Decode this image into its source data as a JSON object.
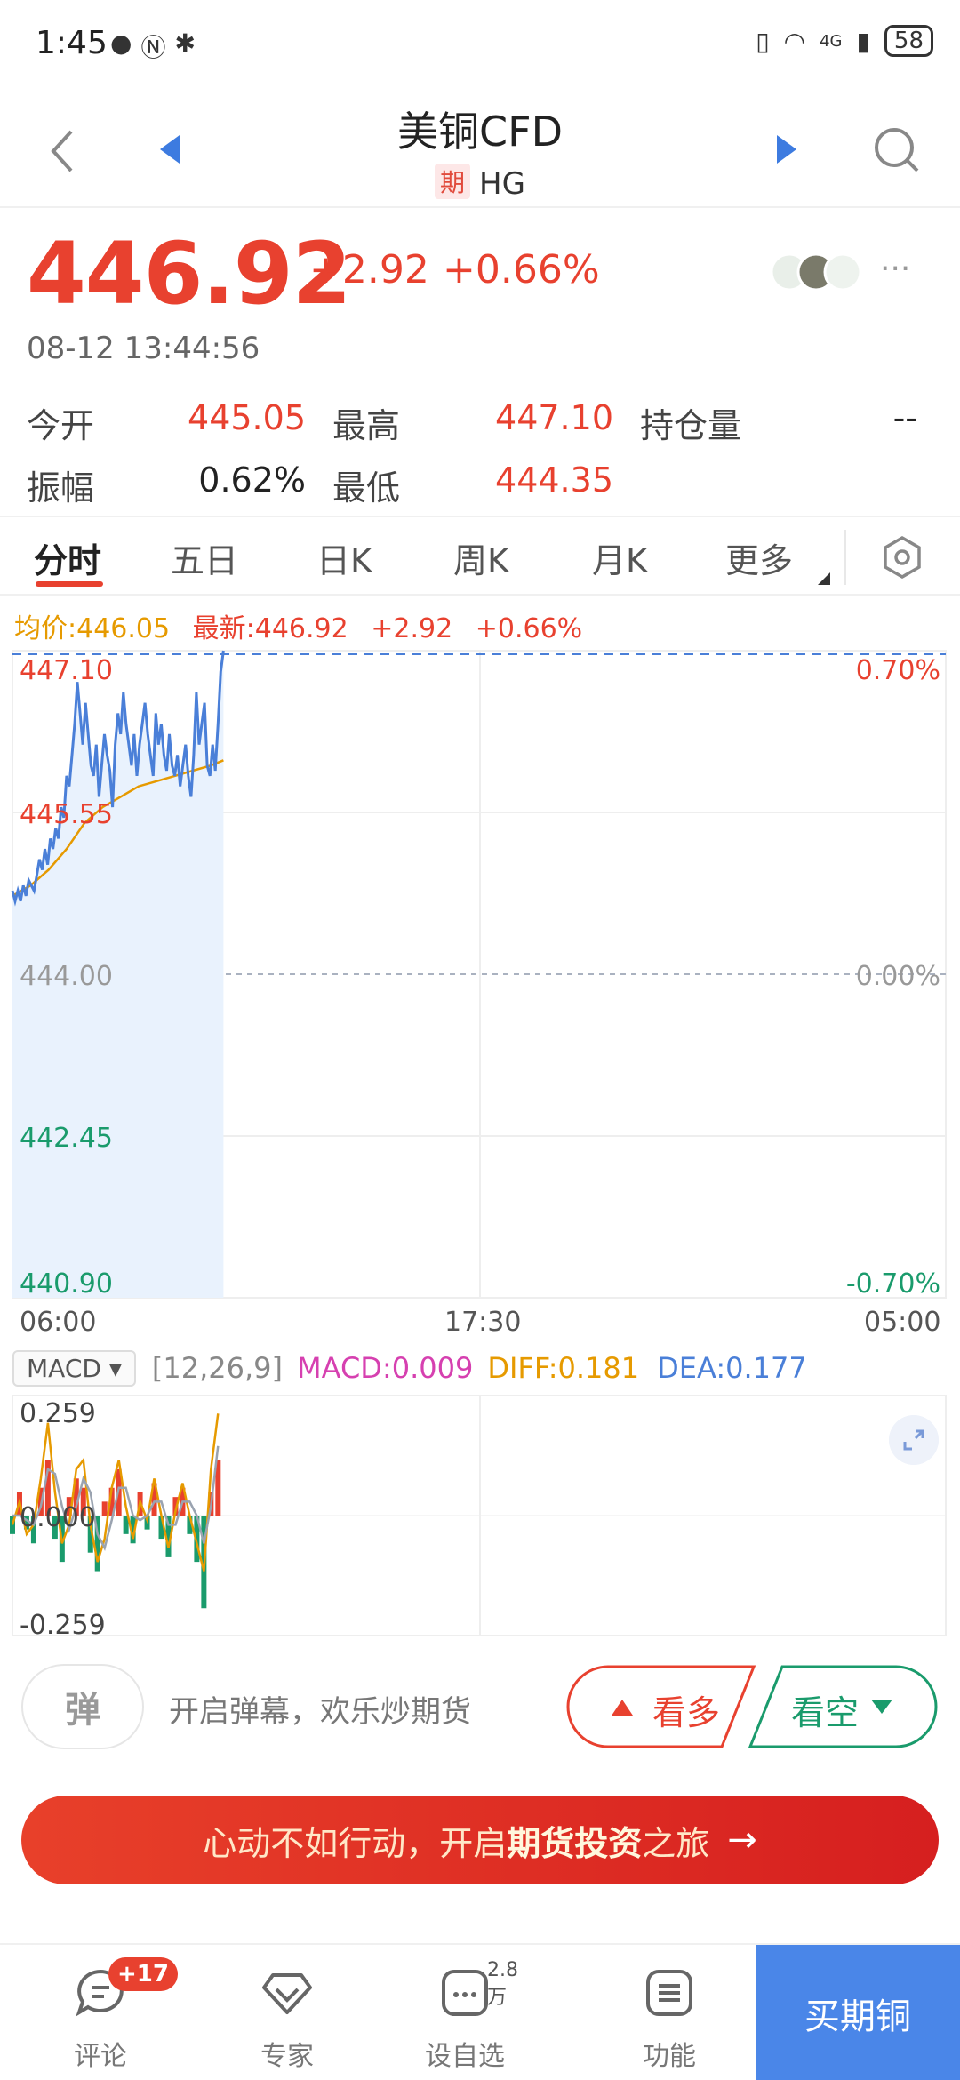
{
  "status_bar": {
    "time": "1:45",
    "battery": "58",
    "network": "4G"
  },
  "header": {
    "title": "美铜CFD",
    "badge": "期",
    "code": "HG"
  },
  "quote": {
    "price": "446.92",
    "change": "+2.92",
    "change_pct": "+0.66%",
    "timestamp": "08-12 13:44:56",
    "more": "···"
  },
  "stats": {
    "open_label": "今开",
    "open": "445.05",
    "high_label": "最高",
    "high": "447.10",
    "oi_label": "持仓量",
    "oi": "--",
    "amp_label": "振幅",
    "amp": "0.62%",
    "low_label": "最低",
    "low": "444.35"
  },
  "tabs": [
    "分时",
    "五日",
    "日K",
    "周K",
    "月K",
    "更多"
  ],
  "chart_info": {
    "avg": "均价:446.05",
    "latest": "最新:446.92",
    "change": "+2.92",
    "pct": "+0.66%"
  },
  "time_axis": [
    "06:00",
    "17:30",
    "05:00"
  ],
  "macd": {
    "selector": "MACD",
    "params": "[12,26,9]",
    "macd": "MACD:0.009",
    "diff": "DIFF:0.181",
    "dea": "DEA:0.177"
  },
  "danmu": {
    "button": "弹",
    "prompt": "开启弹幕，欢乐炒期货"
  },
  "sentiment": {
    "bull": "看多",
    "bear": "看空"
  },
  "banner": {
    "pre": "心动不如行动，开启",
    "bold": "期货投资",
    "post": "之旅",
    "arrow": "→"
  },
  "nav": {
    "comments": "评论",
    "comments_badge": "+17",
    "experts": "专家",
    "watch": "设自选",
    "watch_count": "2.8万",
    "functions": "功能",
    "buy": "买期铜"
  },
  "colors": {
    "up": "#e8412f",
    "down": "#1a9b6c",
    "price_line": "#4a7fd8",
    "avg_line": "#e69a00",
    "accent": "#4a86e8"
  },
  "chart_data": [
    {
      "type": "line",
      "y_ticks_left": [
        "447.10",
        "445.55",
        "444.00",
        "442.45",
        "440.90"
      ],
      "y_ticks_right": [
        "0.70%",
        "0.00%",
        "-0.70%"
      ],
      "ylim": [
        440.9,
        447.1
      ],
      "x_ticks": [
        "06:00",
        "17:30",
        "05:00"
      ],
      "x_index_range": [
        0,
        230
      ],
      "reference": 444.0,
      "latest": 446.92,
      "series": [
        {
          "name": "价格",
          "x": [
            0,
            3,
            6,
            9,
            12,
            15,
            18,
            21,
            24,
            27,
            30,
            33,
            36,
            39,
            42,
            45,
            48,
            51,
            54,
            57,
            60,
            63,
            66,
            69,
            72,
            75,
            78,
            81,
            84,
            87,
            90,
            93,
            96,
            99,
            102,
            105,
            108,
            111,
            114,
            117,
            120,
            123,
            126,
            129,
            132,
            135,
            138,
            141,
            144,
            147,
            150,
            153,
            156,
            159,
            162,
            165,
            168,
            171,
            174,
            177,
            180,
            183,
            186,
            189,
            192,
            195,
            198,
            201,
            204,
            207,
            210,
            213,
            216,
            219,
            222,
            225,
            228,
            231,
            234
          ],
          "values": [
            444.8,
            444.7,
            444.8,
            444.7,
            444.85,
            444.75,
            444.9,
            444.85,
            444.8,
            444.95,
            445.1,
            445.0,
            445.2,
            445.05,
            445.3,
            445.2,
            445.4,
            445.3,
            445.6,
            445.5,
            445.9,
            445.8,
            446.1,
            446.4,
            446.8,
            446.5,
            446.2,
            446.6,
            446.3,
            446.0,
            445.9,
            446.2,
            445.7,
            446.0,
            446.3,
            446.1,
            445.95,
            445.6,
            446.2,
            446.5,
            446.3,
            446.7,
            446.4,
            446.2,
            446.0,
            446.3,
            445.9,
            446.2,
            446.4,
            446.6,
            446.3,
            446.1,
            445.9,
            446.5,
            446.2,
            446.4,
            446.1,
            445.95,
            446.3,
            446.0,
            445.9,
            446.1,
            445.8,
            446.0,
            446.2,
            445.9,
            445.7,
            446.1,
            446.7,
            446.2,
            446.4,
            446.6,
            446.0,
            445.9,
            446.2,
            445.95,
            446.4,
            446.9,
            447.1
          ]
        },
        {
          "name": "均价",
          "x": [
            0,
            20,
            40,
            60,
            80,
            100,
            120,
            140,
            160,
            180,
            200,
            220,
            234
          ],
          "values": [
            444.75,
            444.85,
            445.0,
            445.2,
            445.45,
            445.6,
            445.7,
            445.8,
            445.85,
            445.9,
            445.95,
            446.0,
            446.05
          ]
        }
      ]
    },
    {
      "type": "bar",
      "title": "MACD",
      "params": "[12,26,9]",
      "y_ticks": [
        "0.259",
        "0.000",
        "-0.259"
      ],
      "ylim": [
        -0.259,
        0.259
      ],
      "latest": {
        "macd": 0.009,
        "diff": 0.181,
        "dea": 0.177
      },
      "x": [
        0,
        8,
        16,
        24,
        32,
        40,
        48,
        56,
        64,
        72,
        80,
        88,
        96,
        104,
        112,
        120,
        128,
        136,
        144,
        152,
        160,
        168,
        176,
        184,
        192,
        200,
        208,
        216,
        224,
        232
      ],
      "series": [
        {
          "name": "MACD",
          "values": [
            -0.04,
            0.05,
            -0.03,
            -0.06,
            0.06,
            0.12,
            -0.05,
            -0.1,
            0.04,
            0.08,
            0.06,
            -0.08,
            -0.12,
            0.03,
            0.06,
            0.1,
            -0.04,
            -0.06,
            0.05,
            -0.03,
            0.07,
            -0.05,
            -0.09,
            0.04,
            0.06,
            -0.04,
            -0.1,
            -0.2,
            0.05,
            0.12
          ]
        },
        {
          "name": "DIFF",
          "values": [
            -0.02,
            0.03,
            -0.04,
            -0.02,
            0.08,
            0.2,
            0.05,
            -0.06,
            -0.02,
            0.1,
            0.12,
            -0.02,
            -0.1,
            -0.05,
            0.06,
            0.12,
            0.02,
            -0.05,
            0.03,
            -0.01,
            0.08,
            0.0,
            -0.07,
            0.01,
            0.07,
            0.0,
            -0.06,
            -0.12,
            0.1,
            0.22
          ]
        },
        {
          "name": "DEA",
          "values": [
            0.0,
            0.0,
            -0.01,
            -0.02,
            0.02,
            0.1,
            0.09,
            0.02,
            -0.03,
            0.02,
            0.08,
            0.05,
            -0.04,
            -0.07,
            -0.01,
            0.06,
            0.06,
            0.0,
            -0.01,
            0.0,
            0.03,
            0.03,
            -0.02,
            -0.02,
            0.03,
            0.03,
            0.0,
            -0.06,
            0.02,
            0.15
          ]
        }
      ]
    }
  ]
}
